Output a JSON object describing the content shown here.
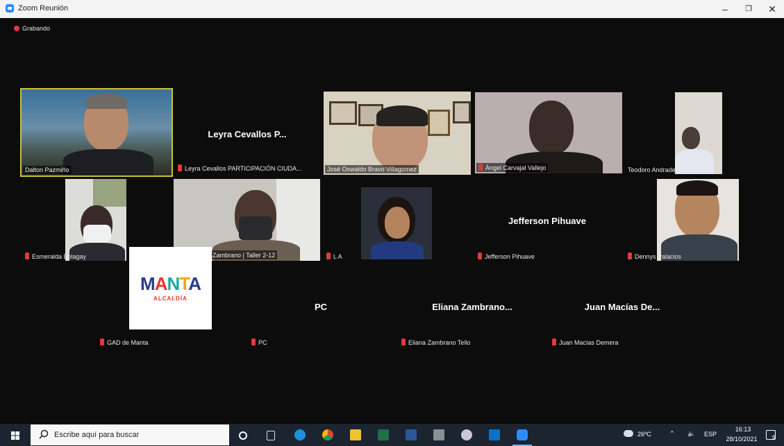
{
  "window": {
    "title": "Zoom Reunión",
    "minimize": "–",
    "maximize": "❐",
    "close": "✕"
  },
  "recording": {
    "label": "Grabando"
  },
  "participants": {
    "dalton": "Dalton Pazmiño",
    "leyra_big": "Leyra Cevallos P...",
    "leyra": "Leyra Cevallos PARTICIPACIÓN CIUDA...",
    "jose": "José Oswaldo Bravo Villagomez",
    "angel": "Ángel Carvajal Vallejo",
    "teodoro": "Teodoro Andrade",
    "esmeralda": "Esmeralda Bolagay",
    "fernando": "Fernando Zambrano | Taller 2-12",
    "la": "L A",
    "jefferson_big": "Jefferson Pihuave",
    "jefferson": "Jefferson Pihuave",
    "dennys": "Dennys Palacios",
    "gad": "GAD de Manta",
    "pc_big": "PC",
    "pc": "PC",
    "eliana_big": "Eliana Zambrano...",
    "eliana": "Eliana Zambrano Tello",
    "juan_big": "Juan Macías De...",
    "juan": "Juan Macías Demera"
  },
  "logo": {
    "name": "MANTA",
    "subtitle": "ALCALDÍA"
  },
  "taskbar": {
    "search_placeholder": "Escribe aquí para buscar",
    "weather": "26ºC",
    "language": "ESP",
    "time": "16:13",
    "date": "28/10/2021",
    "notifications": "6"
  },
  "colors": {
    "accent": "#2d8cff",
    "mute": "#e23a3a",
    "active_border": "#c9c23a"
  }
}
